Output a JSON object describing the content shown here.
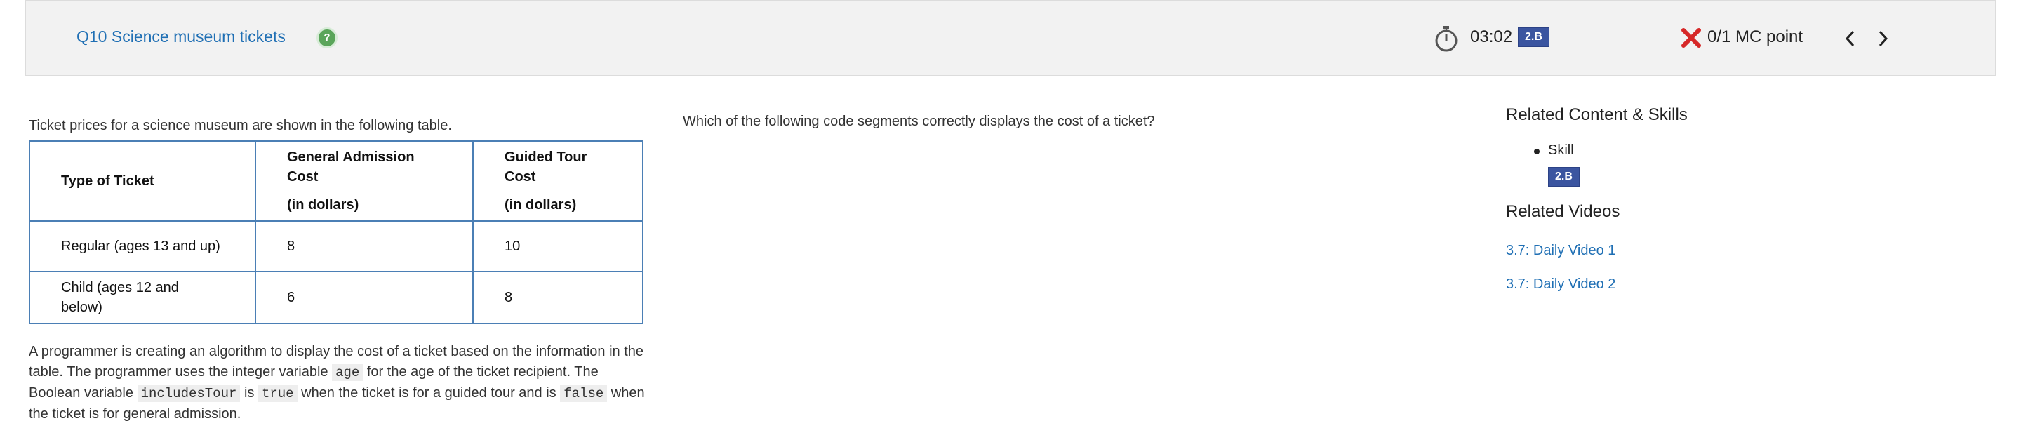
{
  "header": {
    "question_title": "Q10 Science museum tickets",
    "help_icon": "question-mark-icon",
    "help_symbol": "?",
    "timer": "03:02",
    "skill_badge": "2.B",
    "score": "0/1 MC point",
    "colors": {
      "link": "#1f6fb4",
      "badge": "#3b55a0",
      "incorrect": "#d62828",
      "help": "#5aa55a"
    }
  },
  "passage": {
    "intro": "Ticket prices for a science museum are shown in the following table.",
    "table": {
      "headers": [
        [
          "Type of Ticket"
        ],
        [
          "General Admission",
          "Cost",
          "(in dollars)"
        ],
        [
          "Guided Tour",
          "Cost",
          "(in dollars)"
        ]
      ],
      "rows": [
        [
          "Regular (ages 13 and up)",
          "8",
          "10"
        ],
        [
          "Child (ages 12 and below)",
          "6",
          "8"
        ]
      ]
    },
    "paragraph": {
      "p1": "A programmer is creating an algorithm to display the cost of a ticket based on the information in the table. The programmer uses the integer variable ",
      "code1": "age",
      "p2": " for the age of the ticket recipient. The Boolean variable ",
      "code2": "includesTour",
      "p3": " is ",
      "code3": "true",
      "p4": " when the ticket is for a guided tour and is ",
      "code4": "false",
      "p5": " when the ticket is for general admission."
    }
  },
  "question": {
    "text": "Which of the following code segments correctly displays the cost of a ticket?"
  },
  "sidebar": {
    "related_title": "Related Content & Skills",
    "skill_label": "Skill",
    "skill_badge": "2.B",
    "videos_title": "Related Videos",
    "videos": [
      "3.7: Daily Video 1",
      "3.7: Daily Video 2"
    ]
  }
}
